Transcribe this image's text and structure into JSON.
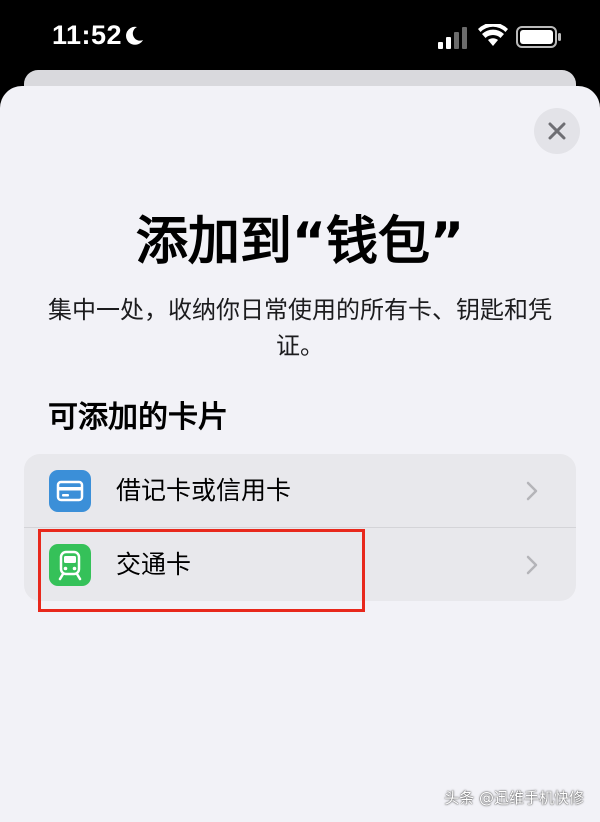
{
  "status_bar": {
    "time": "11:52"
  },
  "sheet": {
    "title": "添加到“钱包”",
    "subtitle": "集中一处，收纳你日常使用的所有卡、钥匙和凭证。",
    "section_header": "可添加的卡片",
    "items": [
      {
        "label": "借记卡或信用卡",
        "icon": "credit-card-icon",
        "color": "#3b8fd8"
      },
      {
        "label": "交通卡",
        "icon": "train-icon",
        "color": "#35c159"
      }
    ]
  },
  "annotation": {
    "highlight_color": "#e8281c"
  },
  "watermark": "头条 @迅维手机快修"
}
